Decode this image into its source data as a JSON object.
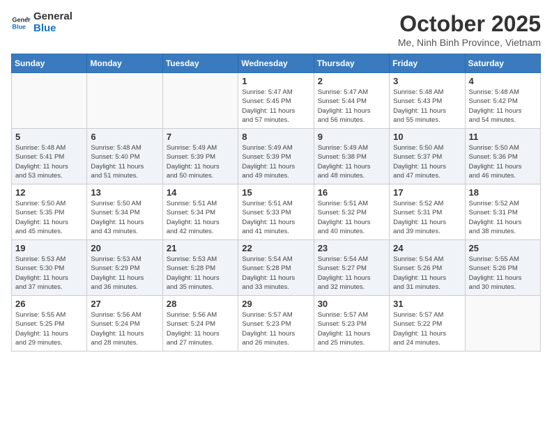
{
  "logo": {
    "line1": "General",
    "line2": "Blue"
  },
  "title": "October 2025",
  "location": "Me, Ninh Binh Province, Vietnam",
  "weekdays": [
    "Sunday",
    "Monday",
    "Tuesday",
    "Wednesday",
    "Thursday",
    "Friday",
    "Saturday"
  ],
  "weeks": [
    [
      {
        "day": "",
        "info": ""
      },
      {
        "day": "",
        "info": ""
      },
      {
        "day": "",
        "info": ""
      },
      {
        "day": "1",
        "info": "Sunrise: 5:47 AM\nSunset: 5:45 PM\nDaylight: 11 hours\nand 57 minutes."
      },
      {
        "day": "2",
        "info": "Sunrise: 5:47 AM\nSunset: 5:44 PM\nDaylight: 11 hours\nand 56 minutes."
      },
      {
        "day": "3",
        "info": "Sunrise: 5:48 AM\nSunset: 5:43 PM\nDaylight: 11 hours\nand 55 minutes."
      },
      {
        "day": "4",
        "info": "Sunrise: 5:48 AM\nSunset: 5:42 PM\nDaylight: 11 hours\nand 54 minutes."
      }
    ],
    [
      {
        "day": "5",
        "info": "Sunrise: 5:48 AM\nSunset: 5:41 PM\nDaylight: 11 hours\nand 53 minutes."
      },
      {
        "day": "6",
        "info": "Sunrise: 5:48 AM\nSunset: 5:40 PM\nDaylight: 11 hours\nand 51 minutes."
      },
      {
        "day": "7",
        "info": "Sunrise: 5:49 AM\nSunset: 5:39 PM\nDaylight: 11 hours\nand 50 minutes."
      },
      {
        "day": "8",
        "info": "Sunrise: 5:49 AM\nSunset: 5:39 PM\nDaylight: 11 hours\nand 49 minutes."
      },
      {
        "day": "9",
        "info": "Sunrise: 5:49 AM\nSunset: 5:38 PM\nDaylight: 11 hours\nand 48 minutes."
      },
      {
        "day": "10",
        "info": "Sunrise: 5:50 AM\nSunset: 5:37 PM\nDaylight: 11 hours\nand 47 minutes."
      },
      {
        "day": "11",
        "info": "Sunrise: 5:50 AM\nSunset: 5:36 PM\nDaylight: 11 hours\nand 46 minutes."
      }
    ],
    [
      {
        "day": "12",
        "info": "Sunrise: 5:50 AM\nSunset: 5:35 PM\nDaylight: 11 hours\nand 45 minutes."
      },
      {
        "day": "13",
        "info": "Sunrise: 5:50 AM\nSunset: 5:34 PM\nDaylight: 11 hours\nand 43 minutes."
      },
      {
        "day": "14",
        "info": "Sunrise: 5:51 AM\nSunset: 5:34 PM\nDaylight: 11 hours\nand 42 minutes."
      },
      {
        "day": "15",
        "info": "Sunrise: 5:51 AM\nSunset: 5:33 PM\nDaylight: 11 hours\nand 41 minutes."
      },
      {
        "day": "16",
        "info": "Sunrise: 5:51 AM\nSunset: 5:32 PM\nDaylight: 11 hours\nand 40 minutes."
      },
      {
        "day": "17",
        "info": "Sunrise: 5:52 AM\nSunset: 5:31 PM\nDaylight: 11 hours\nand 39 minutes."
      },
      {
        "day": "18",
        "info": "Sunrise: 5:52 AM\nSunset: 5:31 PM\nDaylight: 11 hours\nand 38 minutes."
      }
    ],
    [
      {
        "day": "19",
        "info": "Sunrise: 5:53 AM\nSunset: 5:30 PM\nDaylight: 11 hours\nand 37 minutes."
      },
      {
        "day": "20",
        "info": "Sunrise: 5:53 AM\nSunset: 5:29 PM\nDaylight: 11 hours\nand 36 minutes."
      },
      {
        "day": "21",
        "info": "Sunrise: 5:53 AM\nSunset: 5:28 PM\nDaylight: 11 hours\nand 35 minutes."
      },
      {
        "day": "22",
        "info": "Sunrise: 5:54 AM\nSunset: 5:28 PM\nDaylight: 11 hours\nand 33 minutes."
      },
      {
        "day": "23",
        "info": "Sunrise: 5:54 AM\nSunset: 5:27 PM\nDaylight: 11 hours\nand 32 minutes."
      },
      {
        "day": "24",
        "info": "Sunrise: 5:54 AM\nSunset: 5:26 PM\nDaylight: 11 hours\nand 31 minutes."
      },
      {
        "day": "25",
        "info": "Sunrise: 5:55 AM\nSunset: 5:26 PM\nDaylight: 11 hours\nand 30 minutes."
      }
    ],
    [
      {
        "day": "26",
        "info": "Sunrise: 5:55 AM\nSunset: 5:25 PM\nDaylight: 11 hours\nand 29 minutes."
      },
      {
        "day": "27",
        "info": "Sunrise: 5:56 AM\nSunset: 5:24 PM\nDaylight: 11 hours\nand 28 minutes."
      },
      {
        "day": "28",
        "info": "Sunrise: 5:56 AM\nSunset: 5:24 PM\nDaylight: 11 hours\nand 27 minutes."
      },
      {
        "day": "29",
        "info": "Sunrise: 5:57 AM\nSunset: 5:23 PM\nDaylight: 11 hours\nand 26 minutes."
      },
      {
        "day": "30",
        "info": "Sunrise: 5:57 AM\nSunset: 5:23 PM\nDaylight: 11 hours\nand 25 minutes."
      },
      {
        "day": "31",
        "info": "Sunrise: 5:57 AM\nSunset: 5:22 PM\nDaylight: 11 hours\nand 24 minutes."
      },
      {
        "day": "",
        "info": ""
      }
    ]
  ]
}
